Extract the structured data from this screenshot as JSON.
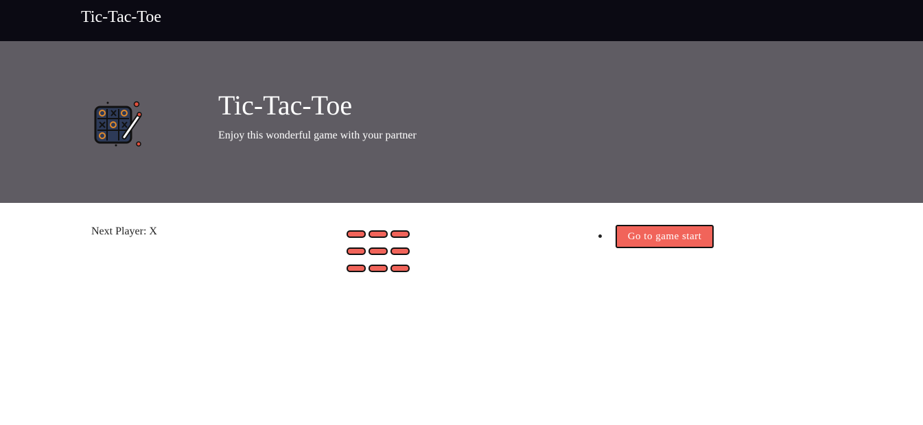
{
  "navbar": {
    "brand": "Tic-Tac-Toe"
  },
  "hero": {
    "logo_icon": "tic-tac-toe-board-icon",
    "title": "Tic-Tac-Toe",
    "subtitle": "Enjoy this wonderful game with your partner"
  },
  "game": {
    "status": "Next Player: X",
    "squares": [
      "",
      "",
      "",
      "",
      "",
      "",
      "",
      "",
      ""
    ],
    "square_color": "#f1645a",
    "moves": [
      {
        "label": "Go to game start"
      }
    ]
  },
  "colors": {
    "navbar": "#0b0a13",
    "hero": "#5f5c63",
    "accent": "#f1645a"
  }
}
